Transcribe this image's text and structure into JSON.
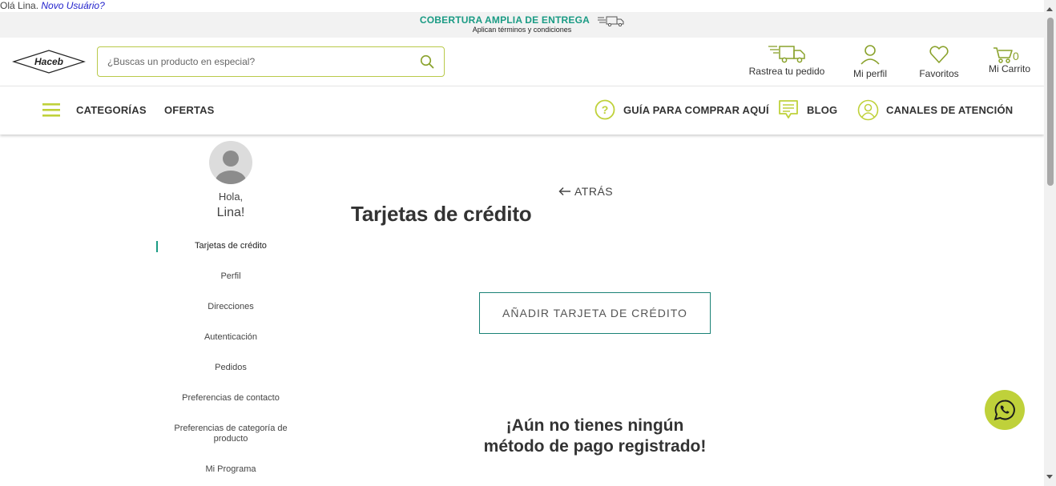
{
  "greeting": {
    "text": "Olá Lina. ",
    "new_user_link": "Novo Usuário?"
  },
  "promo": {
    "title": "COBERTURA AMPLIA DE ENTREGA",
    "subtitle": "Aplican términos y condiciones"
  },
  "header": {
    "logo_text": "Haceb",
    "search_placeholder": "¿Buscas un producto en especial?",
    "actions": {
      "track_label": "Rastrea tu pedido",
      "profile_label": "Mi perfil",
      "favorites_label": "Favoritos",
      "cart_label": "Mi Carrito",
      "cart_count": "0"
    }
  },
  "nav": {
    "categories": "CATEGORÍAS",
    "offers": "OFERTAS",
    "guide": "GUÍA PARA COMPRAR AQUÍ",
    "blog": "BLOG",
    "support": "CANALES DE ATENCIÓN"
  },
  "profile": {
    "hello": "Hola,",
    "name": "Lina!"
  },
  "side_menu": {
    "items": [
      {
        "label": "Tarjetas de crédito",
        "active": true
      },
      {
        "label": "Perfil"
      },
      {
        "label": "Direcciones"
      },
      {
        "label": "Autenticación"
      },
      {
        "label": "Pedidos"
      },
      {
        "label": "Preferencias de contacto"
      },
      {
        "label": "Preferencias de categoría de producto"
      },
      {
        "label": "Mi Programa"
      }
    ]
  },
  "main": {
    "back_label": "ATRÁS",
    "title": "Tarjetas de crédito",
    "add_card_label": "AÑADIR TARJETA DE CRÉDITO",
    "empty_line1": "¡Aún no tienes ningún",
    "empty_line2": "método de pago registrado!"
  },
  "colors": {
    "accent_green": "#bfd13a",
    "teal": "#1a9b84",
    "promo_bg": "#f2f2f2"
  },
  "icons": [
    "truck-icon",
    "search-icon",
    "user-icon",
    "heart-icon",
    "cart-icon",
    "menu-icon",
    "question-icon",
    "blog-icon",
    "support-icon",
    "arrow-left-icon",
    "whatsapp-icon"
  ]
}
